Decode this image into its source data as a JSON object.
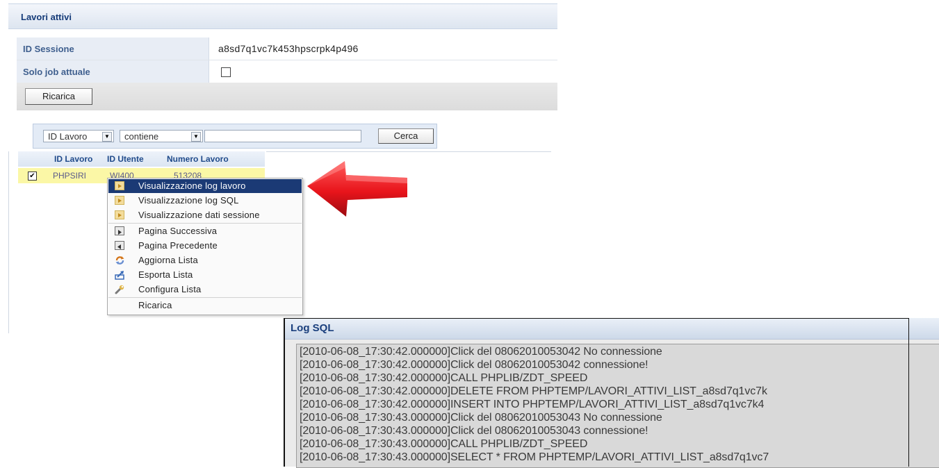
{
  "panel": {
    "title": "Lavori attivi",
    "session_label": "ID Sessione",
    "session_value": "a8sd7q1vc7k453hpscrpk4p496",
    "current_job_label": "Solo job attuale",
    "reload_button": "Ricarica"
  },
  "filter": {
    "field_select": "ID Lavoro",
    "operator_select": "contiene",
    "search_value": "",
    "search_button": "Cerca"
  },
  "grid": {
    "columns": [
      "ID Lavoro",
      "ID Utente",
      "Numero Lavoro"
    ],
    "rows": [
      {
        "checked": true,
        "id_lavoro": "PHPSIRI",
        "id_utente": "WI400",
        "numero_lavoro": "513208"
      }
    ]
  },
  "context_menu": {
    "items": [
      {
        "label": "Visualizzazione log lavoro",
        "icon": "folder-play-icon",
        "active": true
      },
      {
        "label": "Visualizzazione log SQL",
        "icon": "folder-play-icon"
      },
      {
        "label": "Visualizzazione dati sessione",
        "icon": "folder-play-icon"
      },
      {
        "label": "Pagina Successiva",
        "icon": "next-page-icon"
      },
      {
        "label": "Pagina Precedente",
        "icon": "previous-page-icon"
      },
      {
        "label": "Aggiorna Lista",
        "icon": "refresh-icon"
      },
      {
        "label": "Esporta Lista",
        "icon": "export-icon"
      },
      {
        "label": "Configura Lista",
        "icon": "wrench-icon"
      },
      {
        "label": "Ricarica",
        "icon": ""
      }
    ]
  },
  "log_window": {
    "title": "Log SQL",
    "lines": [
      "[2010-06-08_17:30:42.000000]Click del 08062010053042 No connessione",
      "[2010-06-08_17:30:42.000000]Click del 08062010053042 connessione!",
      "[2010-06-08_17:30:42.000000]CALL PHPLIB/ZDT_SPEED",
      "[2010-06-08_17:30:42.000000]DELETE FROM PHPTEMP/LAVORI_ATTIVI_LIST_a8sd7q1vc7k",
      "[2010-06-08_17:30:42.000000]INSERT INTO PHPTEMP/LAVORI_ATTIVI_LIST_a8sd7q1vc7k4",
      "[2010-06-08_17:30:43.000000]Click del 08062010053043 No connessione",
      "[2010-06-08_17:30:43.000000]Click del 08062010053043 connessione!",
      "[2010-06-08_17:30:43.000000]CALL PHPLIB/ZDT_SPEED",
      "[2010-06-08_17:30:43.000000]SELECT * FROM PHPTEMP/LAVORI_ATTIVI_LIST_a8sd7q1vc7"
    ]
  },
  "colors": {
    "header_text": "#143a78",
    "menu_active": "#1b3a75",
    "row_highlight": "#fbf7a6",
    "arrow_red": "#e8141b"
  }
}
